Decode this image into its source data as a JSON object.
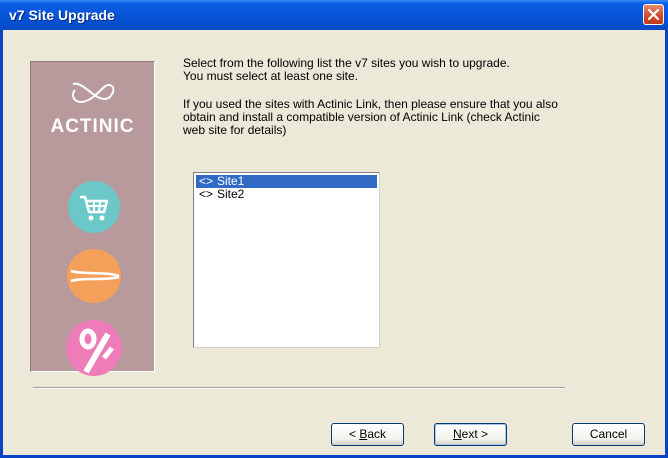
{
  "window": {
    "title": "v7 Site Upgrade",
    "colors": {
      "title_bar": "#0754d8",
      "close_button": "#d0482a",
      "dialog_bg": "#ece9d8",
      "selection": "#316ac5"
    }
  },
  "banner": {
    "brand": "ACTINIC",
    "icons": [
      "actinic-swirl-logo",
      "shopping-cart-icon",
      "orange-lines-icon",
      "percent-icon"
    ],
    "colors": {
      "background": "#b89a9c",
      "cart": "#6cc7c8",
      "orange": "#f5a05a",
      "percent": "#ee7cb8"
    }
  },
  "content": {
    "instruction_line1": "Select from the following list the v7 sites you wish to upgrade.",
    "instruction_line2": "You must select at least one site.",
    "link_note_line1": "If you used the sites with Actinic Link, then please ensure that you also",
    "link_note_line2": "obtain and install a compatible version of Actinic Link (check Actinic",
    "link_note_line3": "web site for details)"
  },
  "sites_list": {
    "items": [
      {
        "marker": "<>",
        "name": "Site1",
        "selected": true
      },
      {
        "marker": "<>",
        "name": "Site2",
        "selected": false
      }
    ]
  },
  "buttons": {
    "back_prefix": "< ",
    "back_accel": "B",
    "back_rest": "ack",
    "next_accel": "N",
    "next_rest": "ext >",
    "cancel": "Cancel"
  }
}
